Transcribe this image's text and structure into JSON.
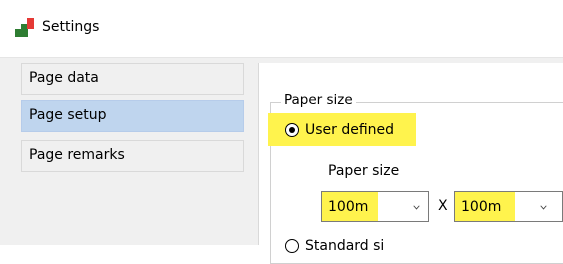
{
  "window": {
    "title": "Settings",
    "icon": "app-logo-icon",
    "colors": {
      "highlight": "#fff34d",
      "selected": "#bfd5ee",
      "icon_green": "#2e7d32",
      "icon_red": "#e53935"
    }
  },
  "sidebar": {
    "items": [
      {
        "label": "Page data",
        "selected": false
      },
      {
        "label": "Page setup",
        "selected": true
      },
      {
        "label": "Page remarks",
        "selected": false
      }
    ]
  },
  "content": {
    "group_label": "Paper size",
    "options": [
      {
        "label": "User defined",
        "checked": true
      },
      {
        "label": "Standard si",
        "checked": false
      }
    ],
    "field_label": "Paper size",
    "width_value": "100m",
    "separator": "X",
    "height_value": "100m"
  }
}
